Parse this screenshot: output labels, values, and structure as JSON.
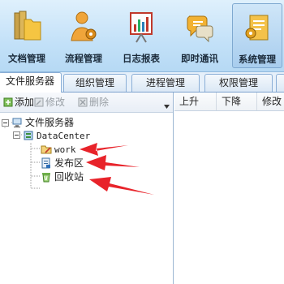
{
  "toolbar": {
    "items": [
      {
        "label": "文档管理",
        "icon": "folder-icon"
      },
      {
        "label": "流程管理",
        "icon": "user-gear-icon"
      },
      {
        "label": "日志报表",
        "icon": "chart-board-icon"
      },
      {
        "label": "即时通讯",
        "icon": "chat-icon"
      },
      {
        "label": "系统管理",
        "icon": "settings-doc-icon"
      }
    ]
  },
  "tabs": [
    "文件服务器",
    "组织管理",
    "进程管理",
    "权限管理"
  ],
  "left_toolbar": {
    "add": "添加",
    "edit": "修改",
    "delete": "删除"
  },
  "tree": {
    "root": "文件服务器",
    "datacenter": "DataCenter",
    "children": [
      "work",
      "发布区",
      "回收站"
    ]
  },
  "right_panel": {
    "columns": [
      "上升",
      "下降",
      "修改"
    ]
  },
  "colors": {
    "annotation_arrow": "#e8232a",
    "toolbar_bg": "#c3e1f8"
  }
}
